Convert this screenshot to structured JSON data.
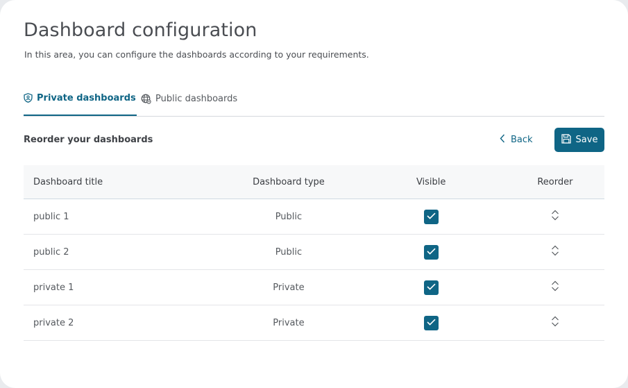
{
  "page": {
    "title": "Dashboard configuration",
    "subtitle": "In this area, you can configure the dashboards according to your requirements."
  },
  "tabs": [
    {
      "label": "Private dashboards",
      "icon": "shield-user-icon",
      "active": true
    },
    {
      "label": "Public dashboards",
      "icon": "globe-icon",
      "active": false
    }
  ],
  "section": {
    "title": "Reorder your dashboards"
  },
  "actions": {
    "back_label": "Back",
    "save_label": "Save"
  },
  "table": {
    "headers": [
      "Dashboard title",
      "Dashboard type",
      "Visible",
      "Reorder"
    ],
    "rows": [
      {
        "title": "public 1",
        "type": "Public",
        "visible": true
      },
      {
        "title": "public 2",
        "type": "Public",
        "visible": true
      },
      {
        "title": "private 1",
        "type": "Private",
        "visible": true
      },
      {
        "title": "private 2",
        "type": "Private",
        "visible": true
      }
    ]
  },
  "colors": {
    "accent": "#0f6585",
    "background": "#ffffff",
    "page_bg": "#e9ebee"
  }
}
